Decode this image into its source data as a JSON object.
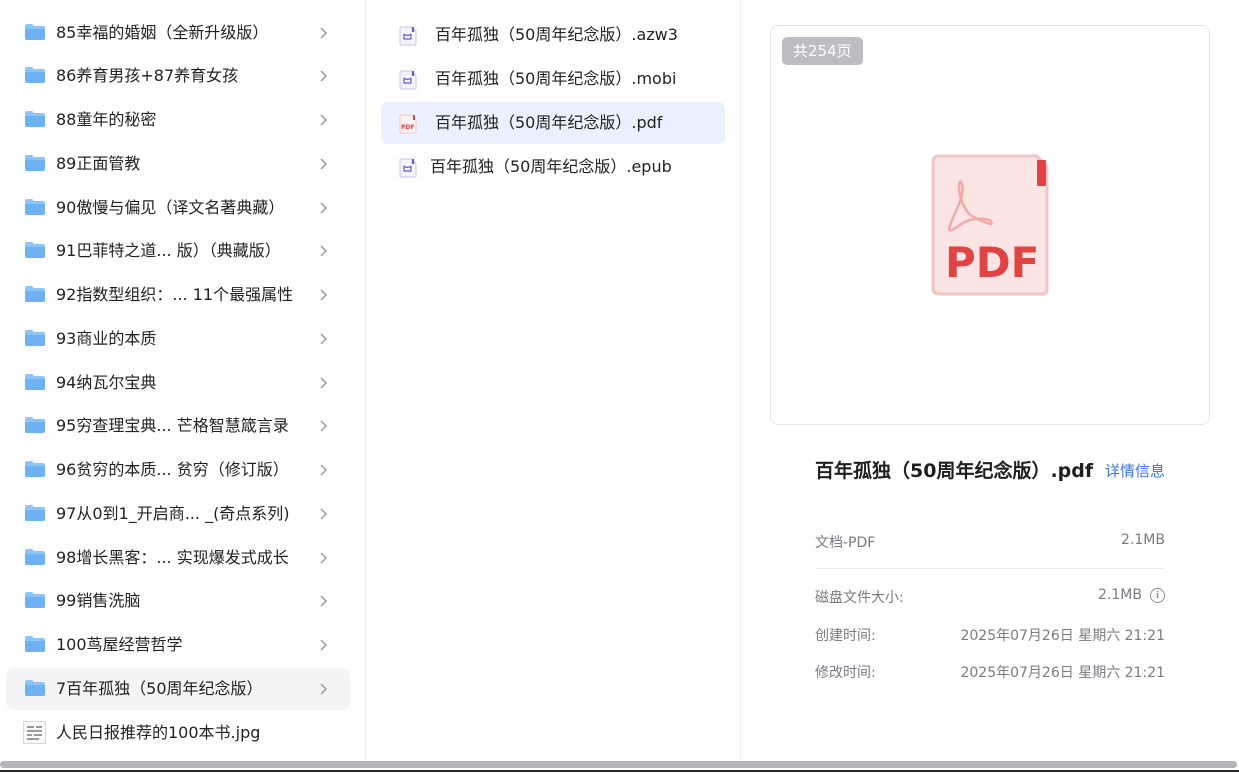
{
  "folders": [
    {
      "label": "85幸福的婚姻（全新升级版）"
    },
    {
      "label": "86养育男孩+87养育女孩"
    },
    {
      "label": "88童年的秘密"
    },
    {
      "label": "89正面管教"
    },
    {
      "label": "90傲慢与偏见（译文名著典藏）"
    },
    {
      "label": "91巴菲特之道... 版）（典藏版）"
    },
    {
      "label": "92指数型组织：... 11个最强属性"
    },
    {
      "label": "93商业的本质"
    },
    {
      "label": "94纳瓦尔宝典"
    },
    {
      "label": "95穷查理宝典... 芒格智慧箴言录"
    },
    {
      "label": "96贫穷的本质... 贫穷（修订版）"
    },
    {
      "label": "97从0到1_开启商... _(奇点系列)"
    },
    {
      "label": "98增长黑客：... 实现爆发式成长"
    },
    {
      "label": "99销售洗脑"
    },
    {
      "label": "100茑屋经营哲学"
    },
    {
      "label": "7百年孤独（50周年纪念版）",
      "selected": true
    }
  ],
  "image_file": {
    "label": "人民日报推荐的100本书.jpg"
  },
  "files": [
    {
      "label": "百年孤独（50周年纪念版）.azw3",
      "type": "ebook"
    },
    {
      "label": "百年孤独（50周年纪念版）.mobi",
      "type": "ebook"
    },
    {
      "label": "百年孤独（50周年纪念版）.pdf",
      "type": "pdf",
      "selected": true
    },
    {
      "label": "百年孤独（50周年纪念版）.epub",
      "type": "ebook"
    }
  ],
  "preview": {
    "page_count": "共254页",
    "icon_text": "PDF",
    "title": "百年孤独（50周年纪念版）.pdf",
    "details_link": "详情信息",
    "doc_type": "文档-PDF",
    "size": "2.1MB",
    "info": {
      "disk_size_label": "磁盘文件大小:",
      "disk_size_value": "2.1MB",
      "created_label": "创建时间:",
      "created_value": "2025年07月26日 星期六 21:21",
      "modified_label": "修改时间:",
      "modified_value": "2025年07月26日 星期六 21:21"
    }
  },
  "colors": {
    "accent": "#3b73e8",
    "folder": "#8dc5f8",
    "pdf_red": "#e04343",
    "selected_bg": "#eaf0fe"
  }
}
